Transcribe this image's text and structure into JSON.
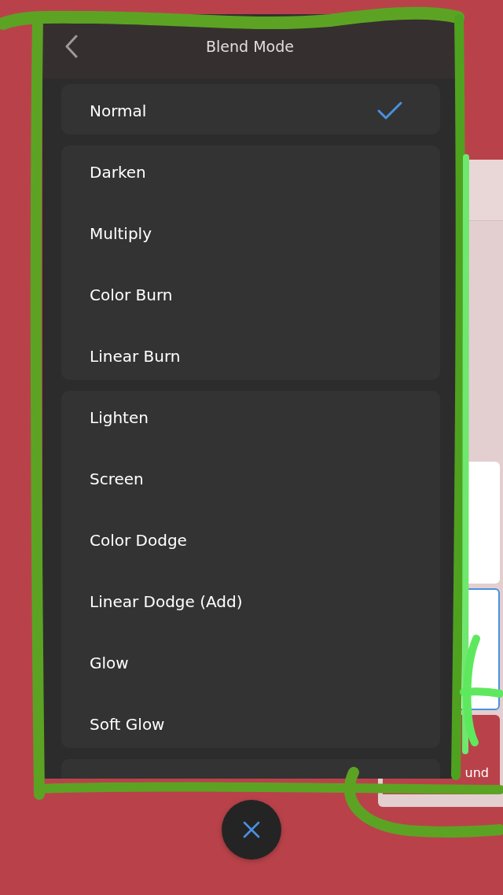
{
  "sheet": {
    "title": "Blend Mode",
    "groups": [
      {
        "modes": [
          {
            "label": "Normal",
            "selected": true
          }
        ]
      },
      {
        "modes": [
          {
            "label": "Darken",
            "selected": false
          },
          {
            "label": "Multiply",
            "selected": false
          },
          {
            "label": "Color Burn",
            "selected": false
          },
          {
            "label": "Linear Burn",
            "selected": false
          }
        ]
      },
      {
        "modes": [
          {
            "label": "Lighten",
            "selected": false
          },
          {
            "label": "Screen",
            "selected": false
          },
          {
            "label": "Color Dodge",
            "selected": false
          },
          {
            "label": "Linear Dodge (Add)",
            "selected": false
          },
          {
            "label": "Glow",
            "selected": false
          },
          {
            "label": "Soft Glow",
            "selected": false
          }
        ]
      }
    ]
  },
  "layers_panel": {
    "layers": [
      {
        "color": "#ffffff",
        "selected": false
      },
      {
        "color": "#ffffff",
        "selected": true
      },
      {
        "color": "#b9424a",
        "selected": false,
        "name": "und"
      }
    ]
  }
}
